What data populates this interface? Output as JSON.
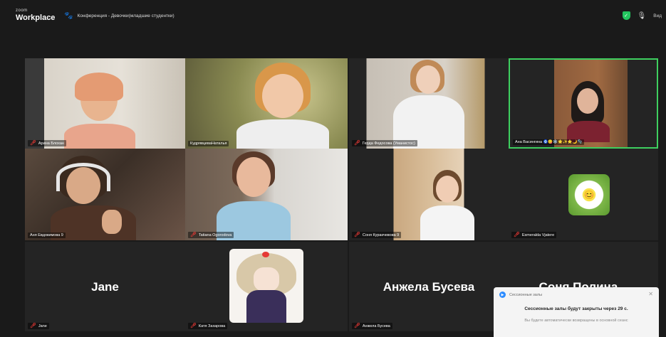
{
  "app": {
    "logo_small": "zoom",
    "logo_big": "Workplace",
    "meeting_title": "Конференция - Девочки(младшие студентки)",
    "view_label": "Вид"
  },
  "participants": [
    {
      "name": "Арина Блохан"
    },
    {
      "name": "КудрявцеваНаталья"
    },
    {
      "name": "Герда Федосова (Уманистос)"
    },
    {
      "name": "Ана Васингина 🧿😋❄️🌟✨⭐🌙🫧"
    },
    {
      "name": "Аня Евдокимова 9"
    },
    {
      "name": "Tatiana Ogorodova"
    },
    {
      "name": "Соня Куракчевова 9"
    },
    {
      "name": "Esmeralda Vjatere"
    },
    {
      "name": "Jane",
      "display": "Jane"
    },
    {
      "name": "Катя Захарова"
    },
    {
      "name": "Анжела Бусева",
      "display": "Анжела Бусева"
    },
    {
      "display": "Соня Полина..."
    }
  ],
  "toast": {
    "header": "Сессионные залы",
    "message": "Сессионные залы будут закрыты через 29 с.",
    "sub": "Вы будете автоматически возвращены в основной сеанс"
  },
  "colors": {
    "active_speaker": "#3ecf5f",
    "muted": "#e53935",
    "shield": "#22c55e"
  }
}
